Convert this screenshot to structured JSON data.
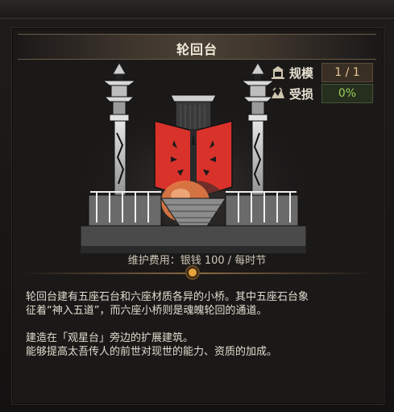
{
  "title": "轮回台",
  "stats": {
    "scale_label": "规模",
    "scale_value": "1 / 1",
    "damage_label": "受损",
    "damage_value": "0%"
  },
  "maintenance": "维护费用：银钱 100 / 每时节",
  "description": {
    "line1": "轮回台建有五座石台和六座材质各异的小桥。其中五座石台象",
    "line2": "征着“神入五道”，而六座小桥则是魂魄轮回的通道。",
    "line3": "建造在「观星台」旁边的扩展建筑。",
    "line4": "能够提高太吾传人的前世对现世的能力、资质的加成。"
  },
  "colors": {
    "banner_red": "#d8322b",
    "scale_value_color": "#e8c898",
    "damage_value_color": "#9ad05a",
    "accent_orange": "#e8a33a"
  },
  "icons": [
    "building-scale-icon",
    "damage-icon"
  ]
}
